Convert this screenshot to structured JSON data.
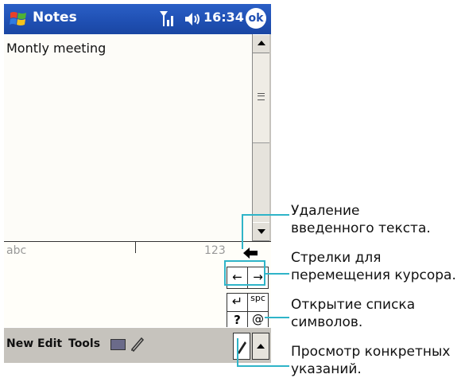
{
  "app": {
    "title": "Notes",
    "time": "16:34",
    "ok_label": "ok"
  },
  "note": {
    "text": "Montly meeting"
  },
  "input_panel": {
    "left_label": "abc",
    "right_label": "123",
    "keys": {
      "enter": "↵",
      "space": "spc",
      "at": "@",
      "help": "?"
    }
  },
  "menu": {
    "new": "New",
    "edit": "Edit",
    "tools": "Tools"
  },
  "callouts": {
    "delete": [
      "Удаление",
      "введенного текста."
    ],
    "arrows": [
      "Стрелки для",
      "перемещения курсора."
    ],
    "symbols": [
      "Открытие списка",
      "символов."
    ],
    "help": [
      "Просмотр конкретных",
      "указаний."
    ]
  },
  "colors": {
    "titlebar": "#1f4fb2",
    "callout_line": "#2fb4c8"
  },
  "icons": [
    "windows-start-icon",
    "signal-icon",
    "speaker-icon",
    "backspace-icon",
    "keyboard-icon",
    "pen-icon"
  ]
}
